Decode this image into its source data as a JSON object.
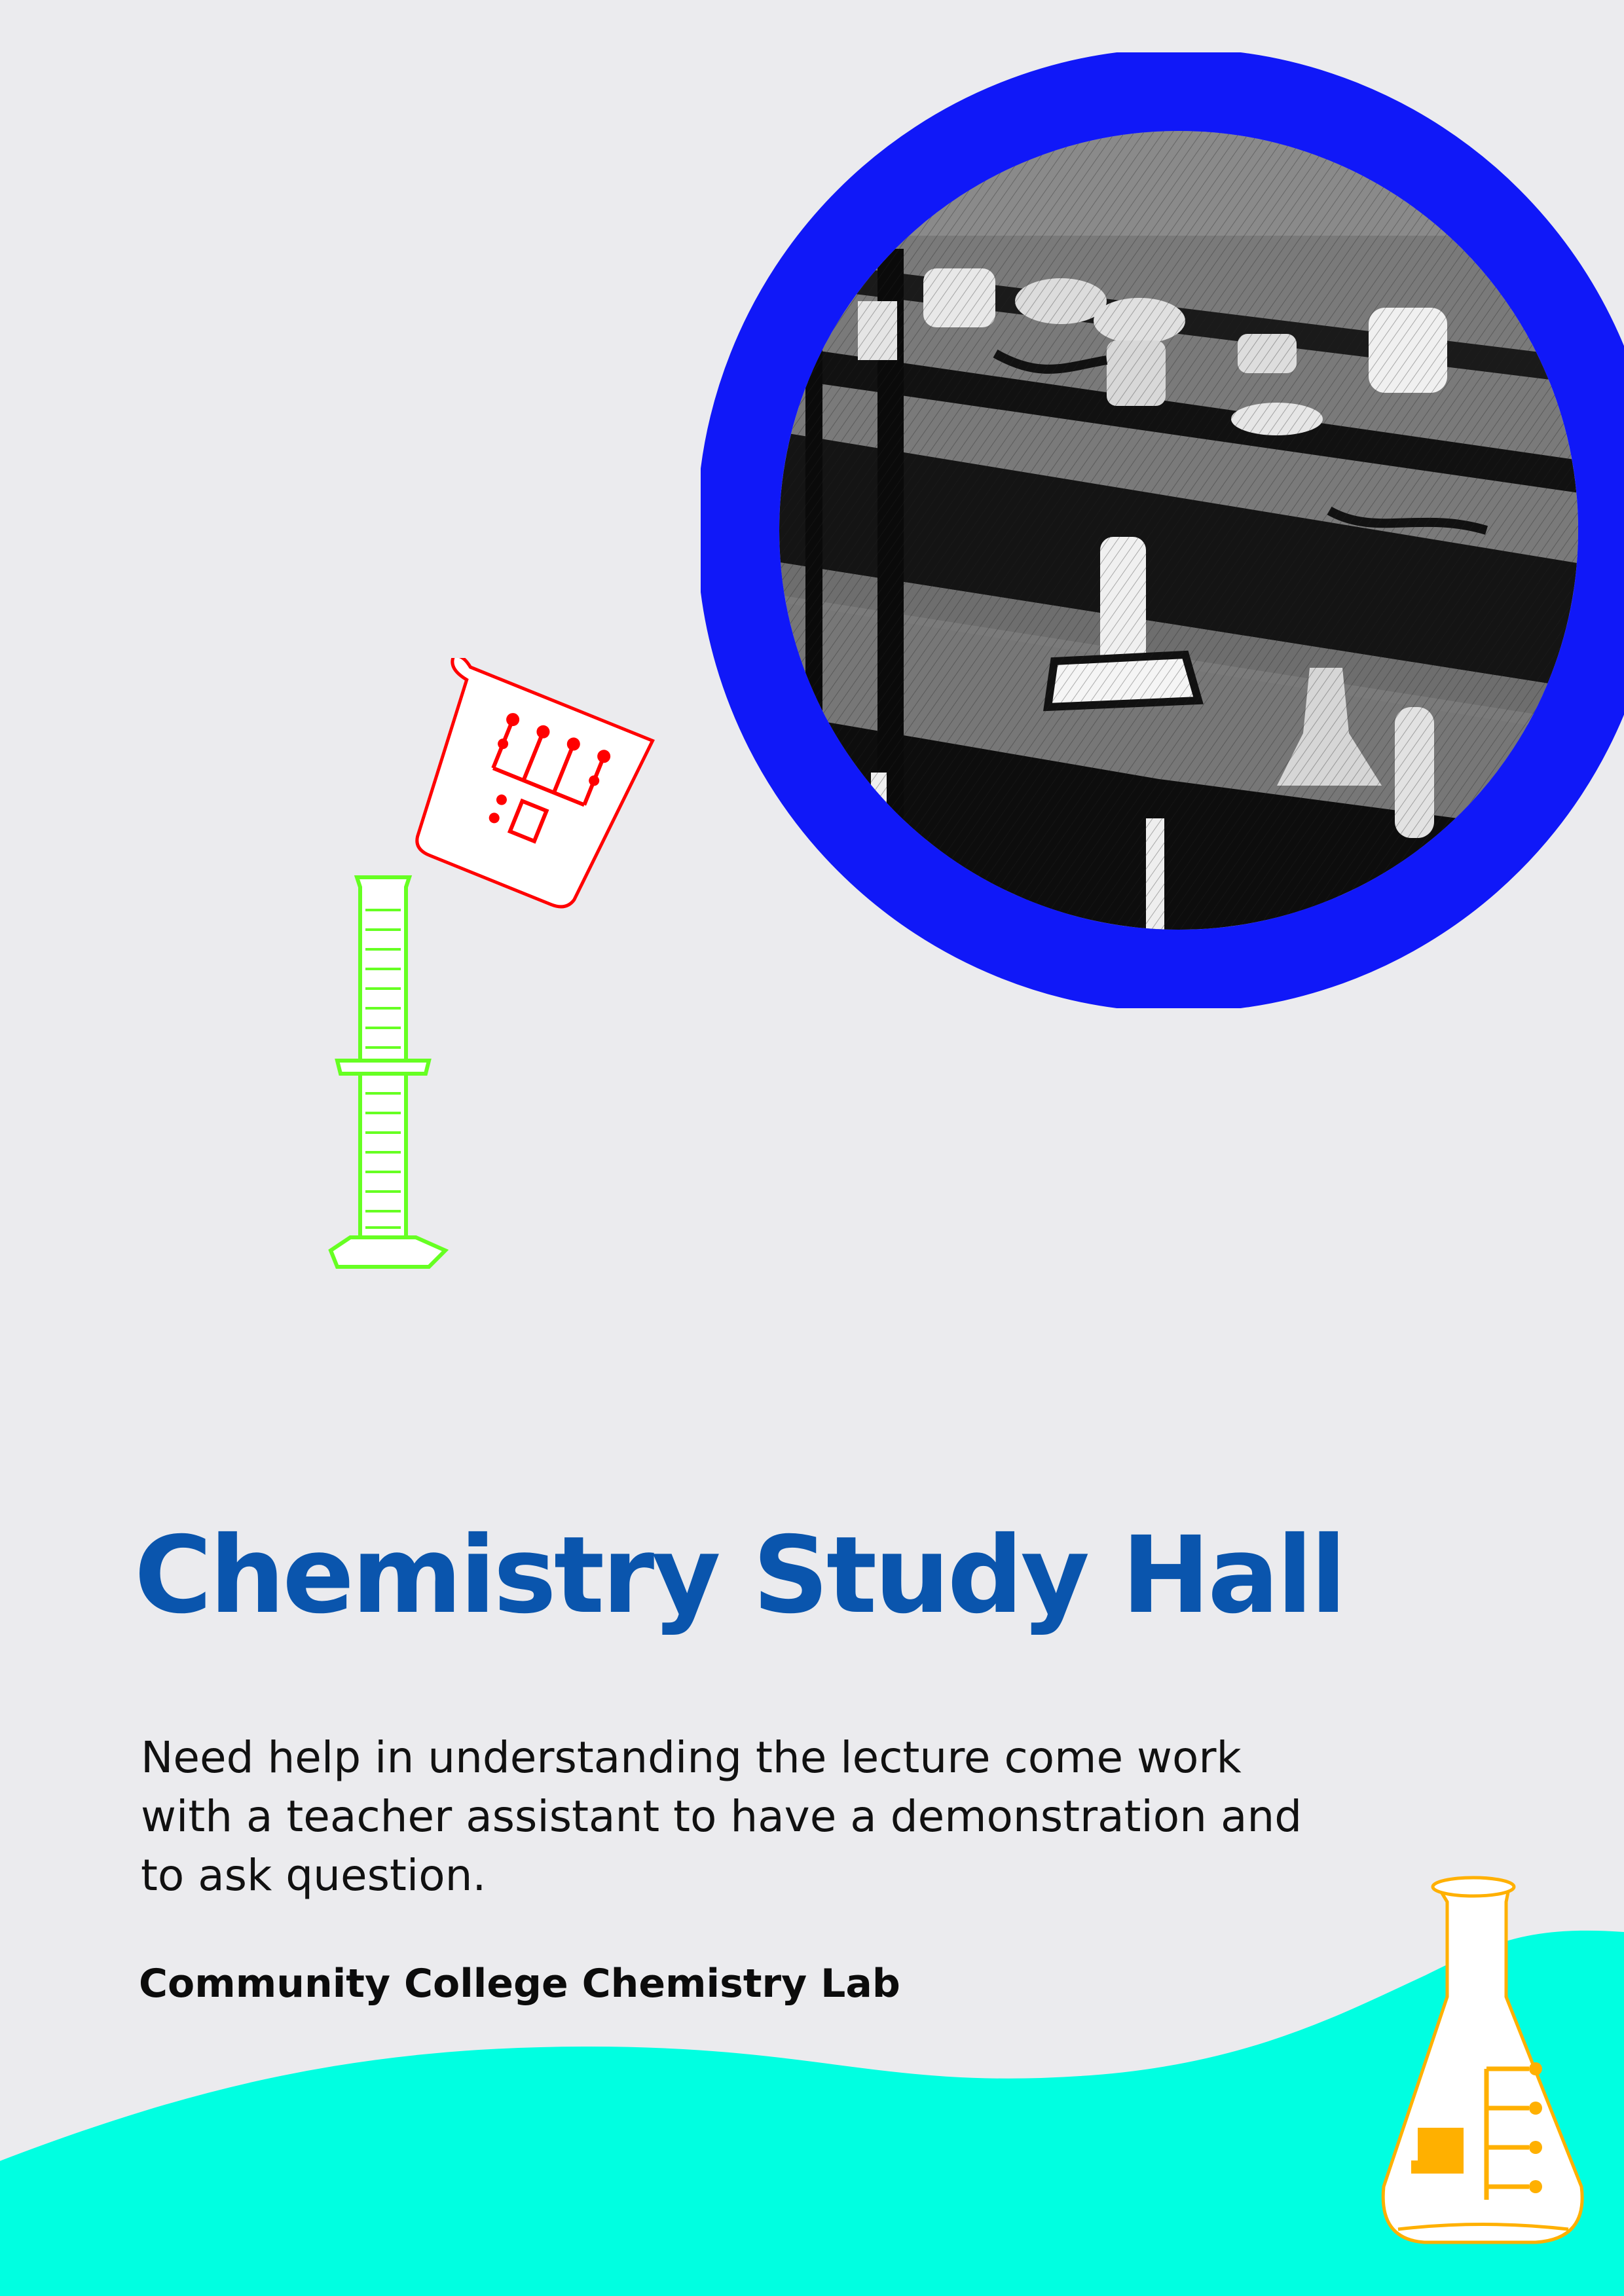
{
  "poster": {
    "title": "Chemistry Study Hall",
    "description": "Need help in understanding the lecture come work with a teacher assistant to have a demonstration and to ask question.",
    "organization": "Community College Chemistry Lab"
  },
  "colors": {
    "background": "#ebebee",
    "title": "#0a55ad",
    "circle_ring": "#1018f8",
    "wave": "#00ffe1",
    "beaker_outline": "#ff0000",
    "cylinder_outline": "#66ff22",
    "flask_outline": "#ffb000"
  },
  "illustrations": {
    "photo": "lab-shelves-photo",
    "beaker": "pouring-beaker-icon",
    "cylinder": "graduated-cylinder-icon",
    "flask": "erlenmeyer-flask-icon"
  }
}
